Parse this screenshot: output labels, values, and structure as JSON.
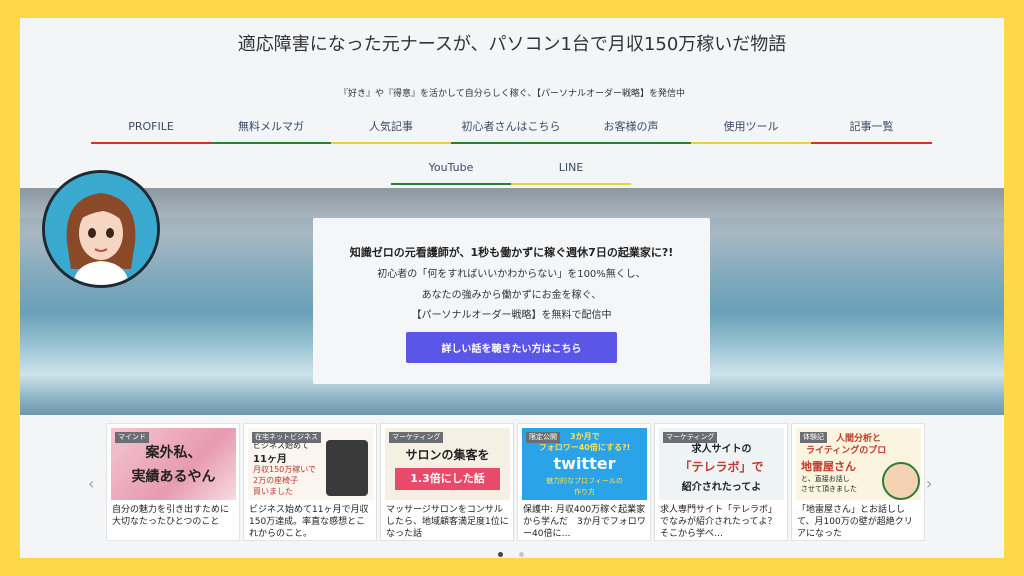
{
  "site": {
    "title": "適応障害になった元ナースが、パソコン1台で月収150万稼いだ物語",
    "tagline": "『好き』や『得意』を活かして自分らしく稼ぐ、【パーソナルオーダー戦略】を発信中"
  },
  "nav": {
    "items": [
      {
        "label": "PROFILE"
      },
      {
        "label": "無料メルマガ"
      },
      {
        "label": "人気記事"
      },
      {
        "label": "初心者さんはこちら"
      },
      {
        "label": "お客様の声"
      },
      {
        "label": "使用ツール"
      },
      {
        "label": "記事一覧"
      },
      {
        "label": "YouTube"
      },
      {
        "label": "LINE"
      }
    ],
    "underline_colors": [
      "#d9302c",
      "#2f7d32",
      "#e8d23a",
      "#2f7d32",
      "#2f7d32",
      "#e8d23a",
      "#d9302c",
      "#2f7d32",
      "#e8d23a"
    ]
  },
  "hero": {
    "headline": "知識ゼロの元看護師が、1秒も働かずに稼ぐ週休7日の起業家に?!",
    "line1": "初心者の「何をすればいいかわからない」を100%無くし、",
    "line2": "あなたの強みから働かずにお金を稼ぐ、",
    "line3": "【パーソナルオーダー戦略】を無料で配信中",
    "cta_label": "詳しい話を聴きたい方はこちら",
    "cta_color": "#5b55e8"
  },
  "carousel": {
    "prev_icon": "‹",
    "next_icon": "›",
    "cards": [
      {
        "category": "マインド",
        "thumb_lines": [
          "案外私、",
          "実績あるやん"
        ],
        "caption": "自分の魅力を引き出すために大切なたったひとつのこと"
      },
      {
        "category": "在宅ネットビジネス",
        "thumb_lines": [
          "ビジネス始めて",
          "11ヶ月",
          "月収150万稼いで",
          "2万の座椅子",
          "買いました"
        ],
        "caption": "ビジネス始めて11ヶ月で月収150万達成。率直な感想とこれからのこと。"
      },
      {
        "category": "マーケティング",
        "thumb_lines": [
          "サロンの集客を",
          "1.3倍にした話"
        ],
        "caption": "マッサージサロンをコンサルしたら、地域顧客満足度1位になった話"
      },
      {
        "category": "限定公開",
        "thumb_lines": [
          "3か月で",
          "フォロワー40倍にする?!",
          "twitter",
          "魅力的なプロフィールの",
          "作り方"
        ],
        "caption": "保護中: 月収400万稼ぐ起業家から学んだ　3か月でフォロワー40倍に…"
      },
      {
        "category": "マーケティング",
        "thumb_lines": [
          "求人サイトの",
          "「テレラボ」で",
          "紹介されたってよ"
        ],
        "caption": "求人専門サイト「テレラボ」でなみが紹介されたってよ？そこから学べ…"
      },
      {
        "category": "体験記",
        "thumb_lines": [
          "人間分析と",
          "ライティングのプロ",
          "地雷屋さん",
          "と、直接お話し",
          "させて頂きました"
        ],
        "caption": "「地雷屋さん」とお話しして、月100万の壁が超絶クリアになった"
      }
    ]
  }
}
